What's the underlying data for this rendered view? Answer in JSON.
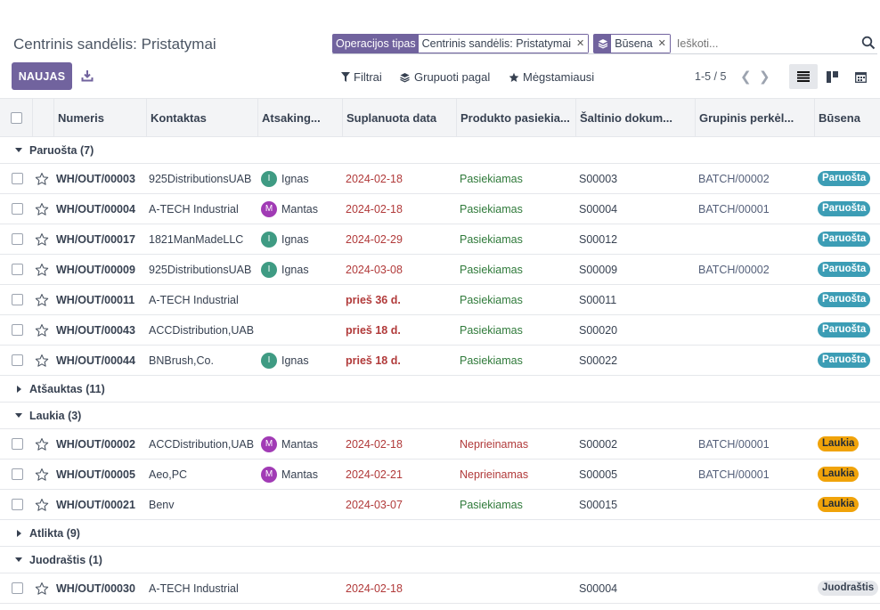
{
  "title": "Centrinis sandėlis: Pristatymai",
  "new_button": "NAUJAS",
  "search": {
    "facets": [
      {
        "label": "Operacijos tipas",
        "value": "Centrinis sandėlis: Pristatymai"
      },
      {
        "icon": "layers-icon",
        "value": "Būsena"
      }
    ],
    "placeholder": "Ieškoti..."
  },
  "toolbar": {
    "filters": "Filtrai",
    "group_by": "Grupuoti pagal",
    "favorites": "Mėgstamiausi"
  },
  "pager": "1-5 / 5",
  "colors": {
    "accent": "#71639e",
    "ready": "#3c9db5",
    "waiting": "#f0a30a",
    "draft": "#e5e7eb",
    "danger": "#b13a3a",
    "success": "#2f7a3a"
  },
  "columns": [
    "Numeris",
    "Kontaktas",
    "Atsaking...",
    "Suplanuota data",
    "Produkto pasiekia...",
    "Šaltinio dokum...",
    "Grupinis perkėl...",
    "Būsena"
  ],
  "groups": [
    {
      "label": "Paruošta (7)",
      "open": true,
      "rows": [
        {
          "number": "WH/OUT/00003",
          "contact": "925DistributionsUAB",
          "user": "Ignas",
          "initial": "I",
          "avatar_color": "#3f9b83",
          "date": "2024-02-18",
          "availability": "Pasiekiamas",
          "avail_status": "ok",
          "source": "S00003",
          "batch": "BATCH/00002",
          "state": "Paruošta",
          "state_kind": "ready"
        },
        {
          "number": "WH/OUT/00004",
          "contact": "A-TECH Industrial",
          "user": "Mantas",
          "initial": "M",
          "avatar_color": "#a13bb5",
          "date": "2024-02-18",
          "availability": "Pasiekiamas",
          "avail_status": "ok",
          "source": "S00004",
          "batch": "BATCH/00001",
          "state": "Paruošta",
          "state_kind": "ready"
        },
        {
          "number": "WH/OUT/00017",
          "contact": "1821ManMadeLLC",
          "user": "Ignas",
          "initial": "I",
          "avatar_color": "#3f9b83",
          "date": "2024-02-29",
          "availability": "Pasiekiamas",
          "avail_status": "ok",
          "source": "S00012",
          "batch": "",
          "state": "Paruošta",
          "state_kind": "ready"
        },
        {
          "number": "WH/OUT/00009",
          "contact": "925DistributionsUAB",
          "user": "Ignas",
          "initial": "I",
          "avatar_color": "#3f9b83",
          "date": "2024-03-08",
          "availability": "Pasiekiamas",
          "avail_status": "ok",
          "source": "S00009",
          "batch": "BATCH/00002",
          "state": "Paruošta",
          "state_kind": "ready"
        },
        {
          "number": "WH/OUT/00011",
          "contact": "A-TECH Industrial",
          "user": "",
          "initial": "",
          "avatar_color": "",
          "date": "prieš 36 d.",
          "date_bold": true,
          "availability": "Pasiekiamas",
          "avail_status": "ok",
          "source": "S00011",
          "batch": "",
          "state": "Paruošta",
          "state_kind": "ready"
        },
        {
          "number": "WH/OUT/00043",
          "contact": "ACCDistribution,UAB",
          "user": "",
          "initial": "",
          "avatar_color": "",
          "date": "prieš 18 d.",
          "date_bold": true,
          "availability": "Pasiekiamas",
          "avail_status": "ok",
          "source": "S00020",
          "batch": "",
          "state": "Paruošta",
          "state_kind": "ready"
        },
        {
          "number": "WH/OUT/00044",
          "contact": "BNBrush,Co.",
          "user": "Ignas",
          "initial": "I",
          "avatar_color": "#3f9b83",
          "date": "prieš 18 d.",
          "date_bold": true,
          "availability": "Pasiekiamas",
          "avail_status": "ok",
          "source": "S00022",
          "batch": "",
          "state": "Paruošta",
          "state_kind": "ready"
        }
      ]
    },
    {
      "label": "Atšauktas (11)",
      "open": false,
      "rows": []
    },
    {
      "label": "Laukia (3)",
      "open": true,
      "rows": [
        {
          "number": "WH/OUT/00002",
          "contact": "ACCDistribution,UAB",
          "user": "Mantas",
          "initial": "M",
          "avatar_color": "#a13bb5",
          "date": "2024-02-18",
          "availability": "Neprieinamas",
          "avail_status": "bad",
          "source": "S00002",
          "batch": "BATCH/00001",
          "state": "Laukia",
          "state_kind": "waiting"
        },
        {
          "number": "WH/OUT/00005",
          "contact": "Aeo,PC",
          "user": "Mantas",
          "initial": "M",
          "avatar_color": "#a13bb5",
          "date": "2024-02-21",
          "availability": "Neprieinamas",
          "avail_status": "bad",
          "source": "S00005",
          "batch": "BATCH/00001",
          "state": "Laukia",
          "state_kind": "waiting"
        },
        {
          "number": "WH/OUT/00021",
          "contact": "Benv",
          "user": "",
          "initial": "",
          "avatar_color": "",
          "date": "2024-03-07",
          "availability": "Pasiekiamas",
          "avail_status": "ok",
          "source": "S00015",
          "batch": "",
          "state": "Laukia",
          "state_kind": "waiting"
        }
      ]
    },
    {
      "label": "Atlikta (9)",
      "open": false,
      "rows": []
    },
    {
      "label": "Juodraštis (1)",
      "open": true,
      "rows": [
        {
          "number": "WH/OUT/00030",
          "contact": "A-TECH Industrial",
          "user": "",
          "initial": "",
          "avatar_color": "",
          "date": "2024-02-18",
          "availability": "",
          "avail_status": "",
          "source": "S00004",
          "batch": "",
          "state": "Juodraštis",
          "state_kind": "draft"
        }
      ]
    }
  ]
}
